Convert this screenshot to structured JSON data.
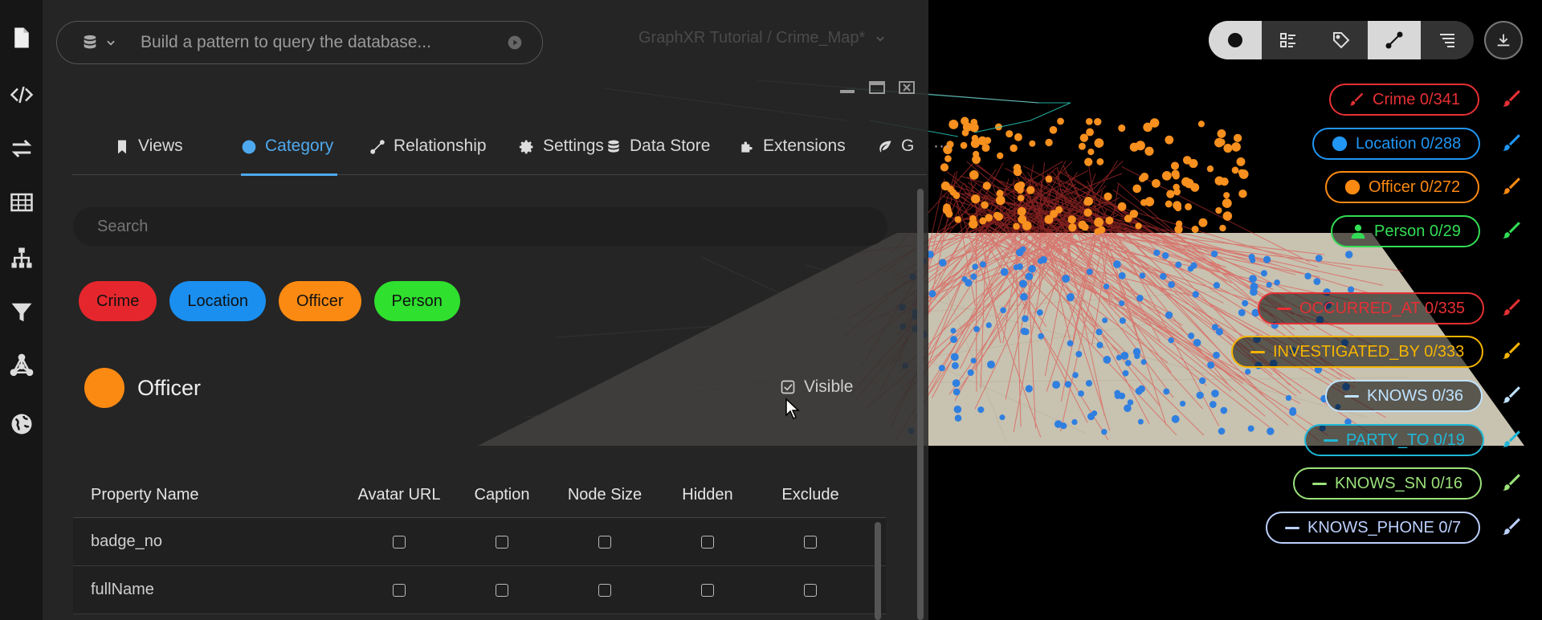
{
  "query": {
    "placeholder": "Build a pattern to query the database..."
  },
  "breadcrumb": {
    "text": "GraphXR Tutorial / Crime_Map*"
  },
  "tabs": [
    {
      "label": "Views"
    },
    {
      "label": "Category"
    },
    {
      "label": "Relationship"
    },
    {
      "label": "Settings"
    },
    {
      "label": "Data Store"
    },
    {
      "label": "Extensions"
    },
    {
      "label": "G"
    }
  ],
  "more_label": "···",
  "search": {
    "placeholder": "Search"
  },
  "categories": [
    {
      "label": "Crime",
      "color": "#e5272d"
    },
    {
      "label": "Location",
      "color": "#1a8ff0"
    },
    {
      "label": "Officer",
      "color": "#fb8a12"
    },
    {
      "label": "Person",
      "color": "#2fe02f"
    }
  ],
  "selected_category": {
    "name": "Officer",
    "color": "#fb8a12",
    "visible_label": "Visible"
  },
  "property_table": {
    "headers": [
      "Property Name",
      "Avatar URL",
      "Caption",
      "Node Size",
      "Hidden",
      "Exclude"
    ],
    "rows": [
      {
        "name": "badge_no"
      },
      {
        "name": "fullName"
      }
    ]
  },
  "legend_nodes": [
    {
      "label": "Crime 0/341",
      "color": "#e53034"
    },
    {
      "label": "Location 0/288",
      "color": "#2196f3"
    },
    {
      "label": "Officer 0/272",
      "color": "#fb8a12"
    },
    {
      "label": "Person 0/29",
      "color": "#33dd55"
    }
  ],
  "legend_edges": [
    {
      "label": "OCCURRED_AT 0/335",
      "color": "#e53034"
    },
    {
      "label": "INVESTIGATED_BY 0/333",
      "color": "#f4b400"
    },
    {
      "label": "KNOWS 0/36",
      "color": "#bfe3ff"
    },
    {
      "label": "PARTY_TO 0/19",
      "color": "#1fb8d8"
    },
    {
      "label": "KNOWS_SN 0/16",
      "color": "#9be27a"
    },
    {
      "label": "KNOWS_PHONE 0/7",
      "color": "#bcd0ff"
    }
  ]
}
